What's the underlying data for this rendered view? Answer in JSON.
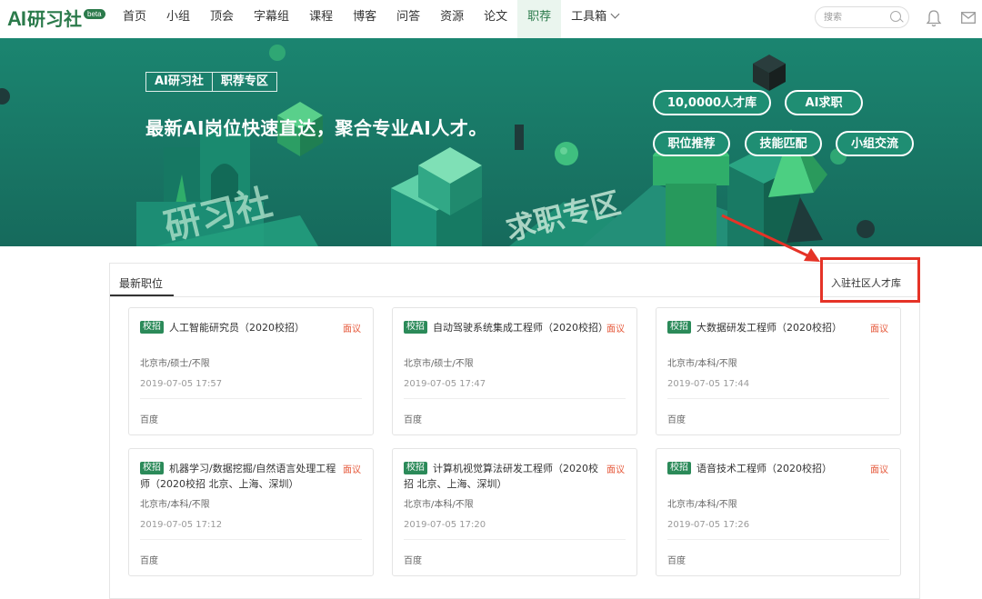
{
  "logo": {
    "ai": "AI",
    "cn": "研习社",
    "badge": "beta"
  },
  "nav": [
    {
      "label": "首页"
    },
    {
      "label": "小组"
    },
    {
      "label": "顶会"
    },
    {
      "label": "字幕组"
    },
    {
      "label": "课程"
    },
    {
      "label": "博客"
    },
    {
      "label": "问答"
    },
    {
      "label": "资源"
    },
    {
      "label": "论文"
    },
    {
      "label": "职荐",
      "active": true
    },
    {
      "label": "工具箱",
      "dropdown": true
    }
  ],
  "search": {
    "placeholder": "搜索",
    "value": ""
  },
  "banner": {
    "tag_left": "AI研习社",
    "tag_right": "职荐专区",
    "slogan": "最新AI岗位快速直达，聚合专业AI人才。",
    "buttons": [
      "10,0000人才库",
      "AI求职",
      "职位推荐",
      "技能匹配",
      "小组交流"
    ],
    "art_text_1": "研习社",
    "art_text_2": "求职专区"
  },
  "panel": {
    "tab": "最新职位",
    "join_link": "入驻社区人才库"
  },
  "cards": [
    {
      "tag": "校招",
      "title": "人工智能研究员（2020校招）",
      "salary": "面议",
      "meta": "北京市/硕士/不限",
      "time": "2019-07-05 17:57",
      "company": "百度"
    },
    {
      "tag": "校招",
      "title": "自动驾驶系统集成工程师（2020校招）",
      "salary": "面议",
      "meta": "北京市/硕士/不限",
      "time": "2019-07-05 17:47",
      "company": "百度"
    },
    {
      "tag": "校招",
      "title": "大数据研发工程师（2020校招）",
      "salary": "面议",
      "meta": "北京市/本科/不限",
      "time": "2019-07-05 17:44",
      "company": "百度"
    },
    {
      "tag": "校招",
      "title": "机器学习/数据挖掘/自然语言处理工程师（2020校招 北京、上海、深圳）",
      "salary": "面议",
      "meta": "北京市/本科/不限",
      "time": "2019-07-05 17:12",
      "company": "百度"
    },
    {
      "tag": "校招",
      "title": "计算机视觉算法研发工程师（2020校招 北京、上海、深圳）",
      "salary": "面议",
      "meta": "北京市/本科/不限",
      "time": "2019-07-05 17:20",
      "company": "百度"
    },
    {
      "tag": "校招",
      "title": "语音技术工程师（2020校招）",
      "salary": "面议",
      "meta": "北京市/本科/不限",
      "time": "2019-07-05 17:26",
      "company": "百度"
    }
  ],
  "colors": {
    "brand": "#2b7a4b",
    "banner": "#1d7a6a",
    "salary": "#e65a3c",
    "highlight": "#e53327"
  }
}
